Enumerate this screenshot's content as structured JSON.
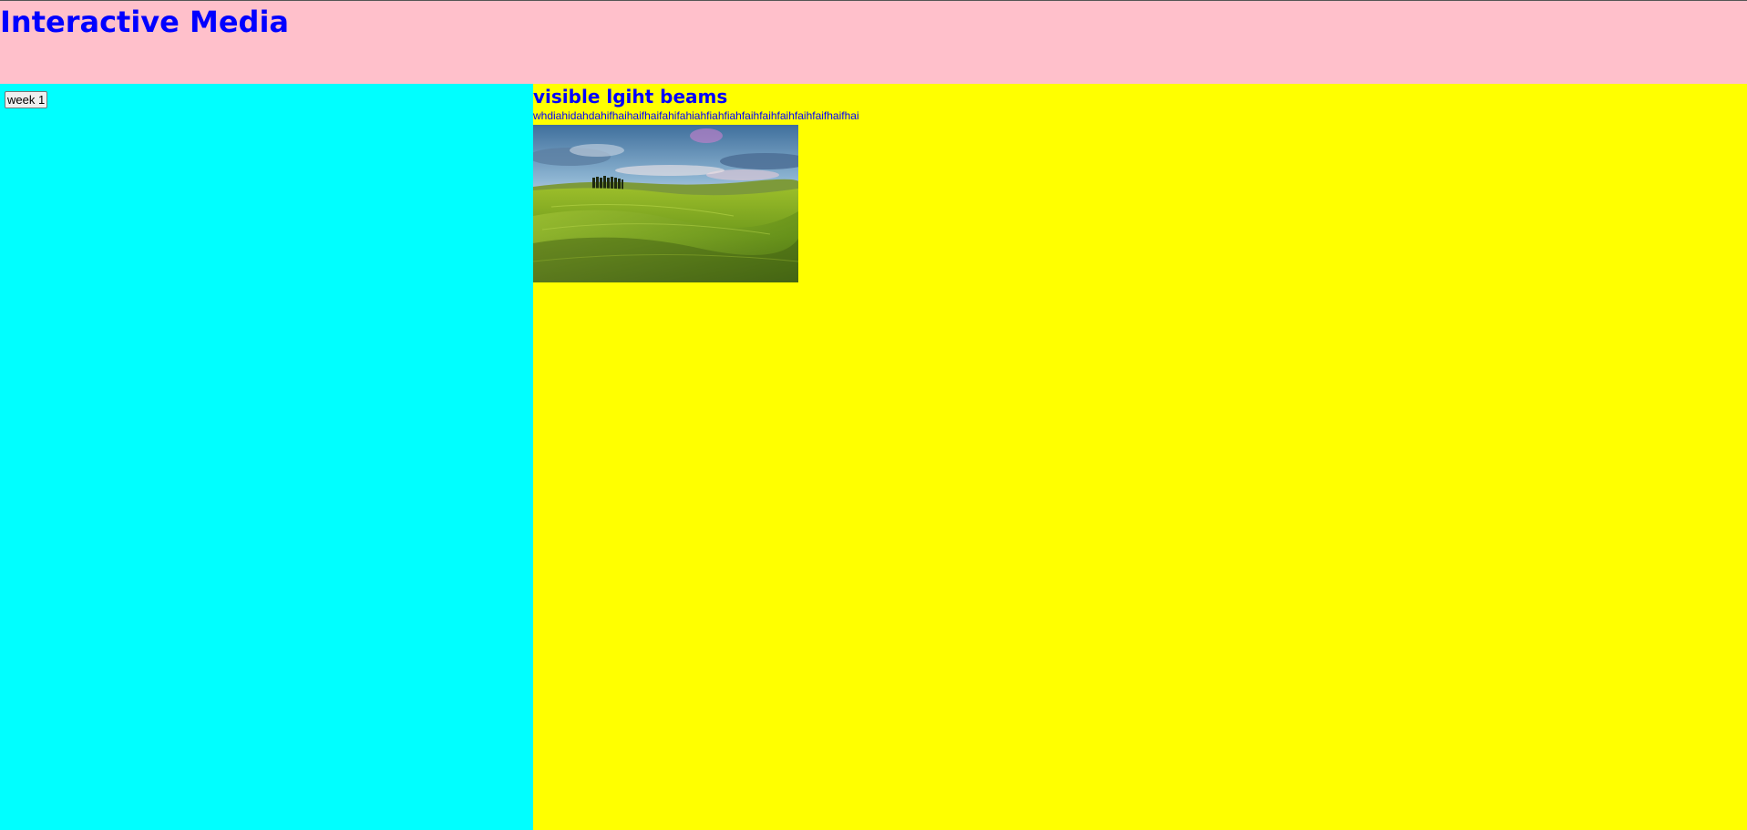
{
  "header": {
    "title": "Interactive Media",
    "background": "#ffc0cb",
    "title_color": "#0000ff"
  },
  "sidebar": {
    "background": "#00ffff",
    "button_label": "week 1"
  },
  "main": {
    "background": "#ffff00",
    "heading": "visible lgiht beams",
    "body_text": "whdiahidahdahifhaihaifhaifahifahiahfiahfiahfaihfaihfaihfaihfaifhaifhai",
    "text_color": "#0000ff",
    "image": {
      "subject": "green-rolling-hills-landscape"
    }
  }
}
